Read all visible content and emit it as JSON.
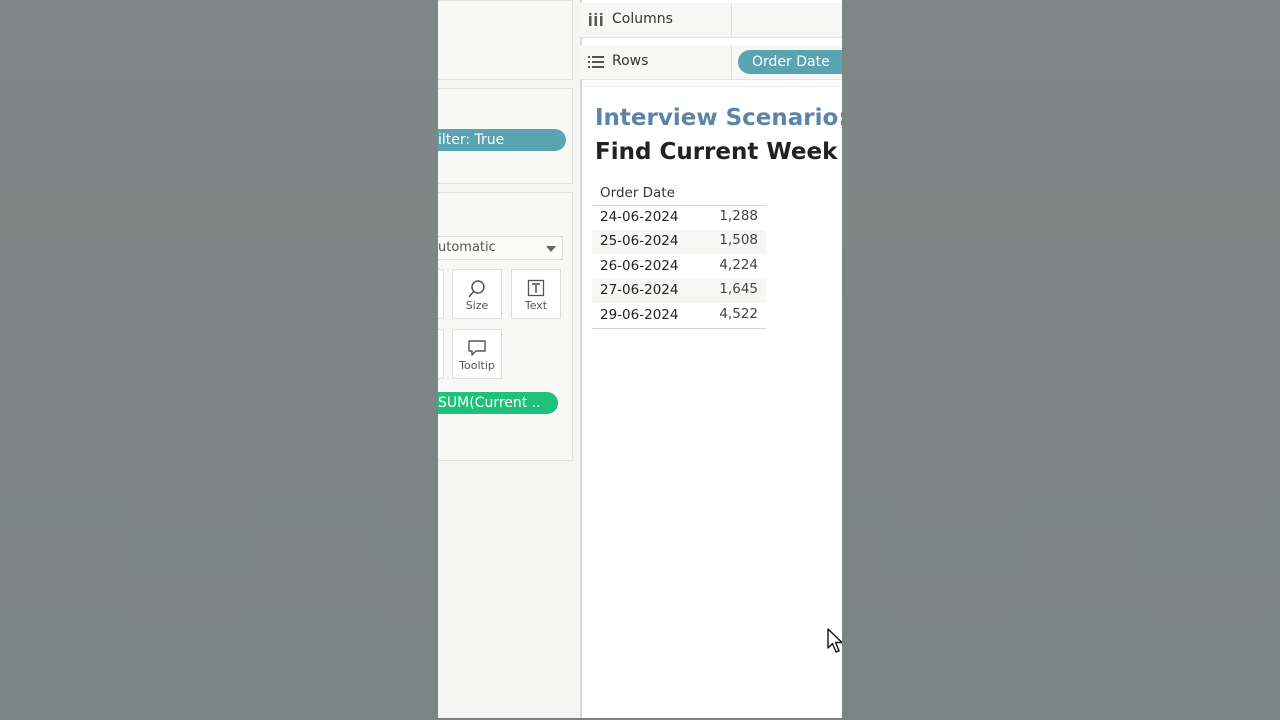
{
  "sidebar": {
    "filter_pill": "ilter: True",
    "mark_type_dropdown": "utomatic",
    "marks_buttons": [
      {
        "label": "Size",
        "icon": "size-icon"
      },
      {
        "label": "Text",
        "icon": "text-icon"
      },
      {
        "label": "Tooltip",
        "icon": "tooltip-icon"
      }
    ],
    "measure_pill": "SUM(Current .."
  },
  "shelves": {
    "columns_label": "Columns",
    "rows_label": "Rows",
    "rows_pill": "Order Date"
  },
  "view": {
    "title_line1": "Interview Scenario:",
    "title_line2": "Find Current Week Sa",
    "table": {
      "header": "Order Date",
      "rows": [
        {
          "date": "24-06-2024",
          "value": "1,288"
        },
        {
          "date": "25-06-2024",
          "value": "1,508"
        },
        {
          "date": "26-06-2024",
          "value": "4,224"
        },
        {
          "date": "27-06-2024",
          "value": "1,645"
        },
        {
          "date": "29-06-2024",
          "value": "4,522"
        }
      ]
    }
  },
  "colors": {
    "dimension_pill": "#5aa3b1",
    "measure_pill": "#1fc27a",
    "title_accent": "#5b84a8"
  }
}
